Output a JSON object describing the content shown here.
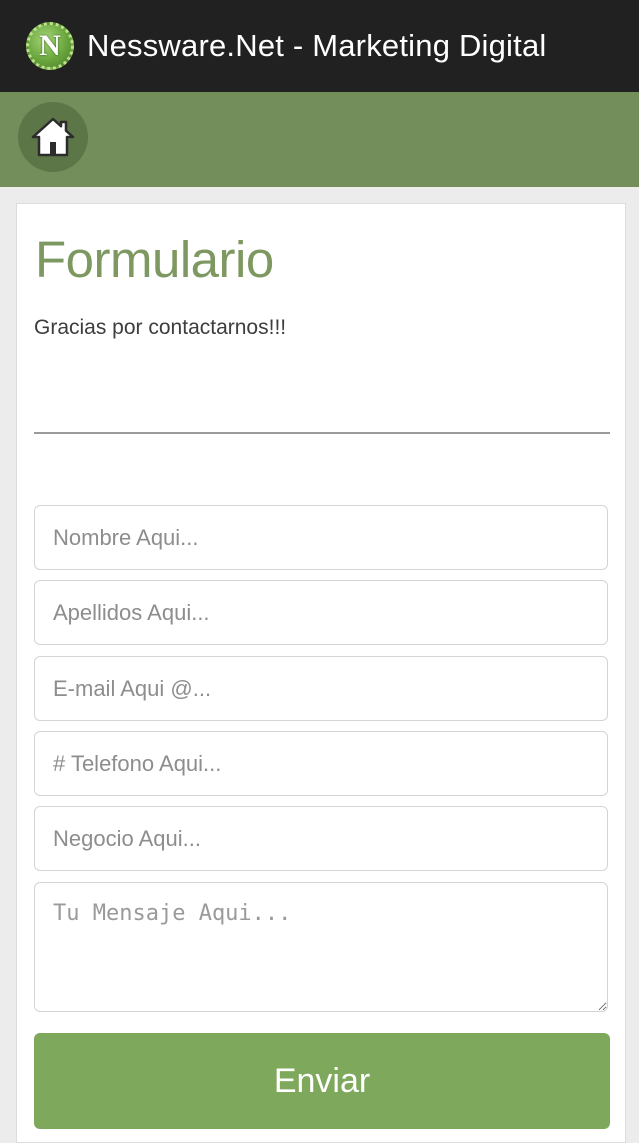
{
  "app": {
    "logo_letter": "N",
    "title": "Nessware.Net - Marketing Digital"
  },
  "navbar": {
    "home_icon": "home-icon"
  },
  "form": {
    "title": "Formulario",
    "subtitle": "Gracias por contactarnos!!!",
    "fields": {
      "nombre": {
        "placeholder": "Nombre Aqui...",
        "value": ""
      },
      "apellidos": {
        "placeholder": "Apellidos Aqui...",
        "value": ""
      },
      "email": {
        "placeholder": "E-mail Aqui @...",
        "value": ""
      },
      "telefono": {
        "placeholder": "# Telefono Aqui...",
        "value": ""
      },
      "negocio": {
        "placeholder": "Negocio Aqui...",
        "value": ""
      },
      "mensaje": {
        "placeholder": "Tu Mensaje Aqui...",
        "value": ""
      }
    },
    "submit_label": "Enviar"
  },
  "colors": {
    "titlebar": "#212121",
    "navbar": "#748e5b",
    "accent": "#7ea85b",
    "title_text": "#7d9860"
  }
}
